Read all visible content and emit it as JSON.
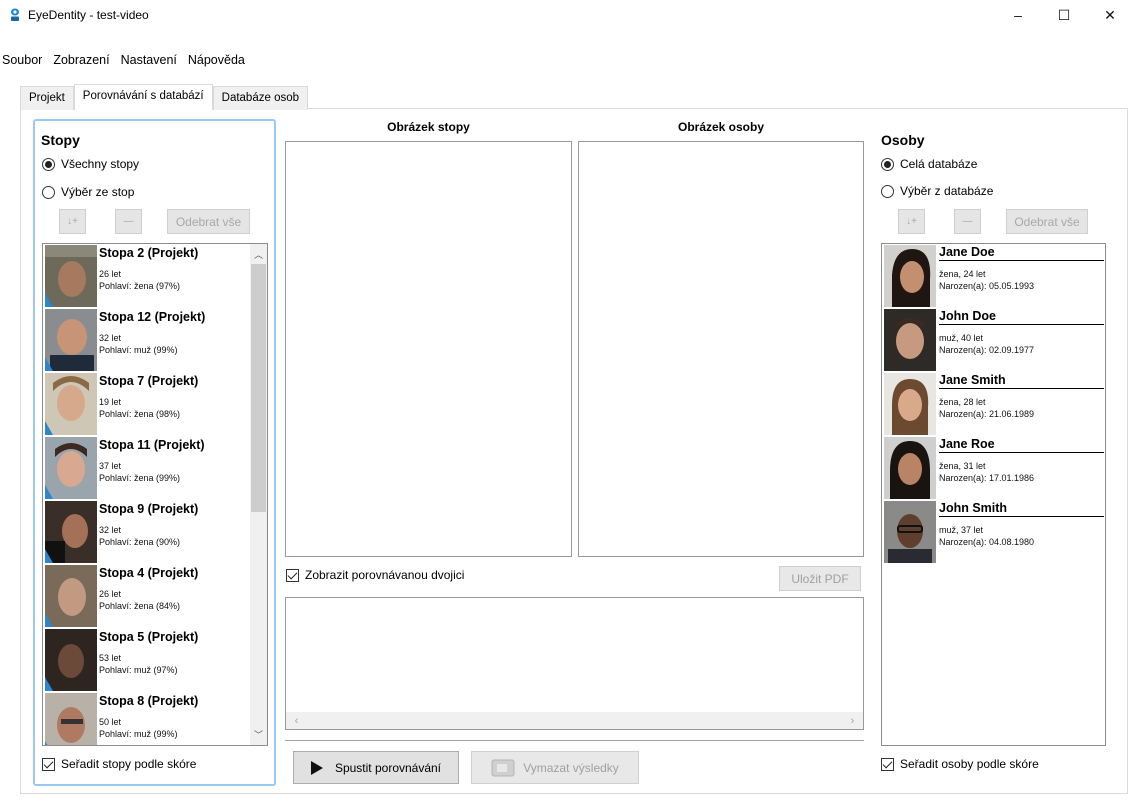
{
  "window": {
    "title": "EyeDentity - test-video",
    "minimize": "–",
    "maximize": "☐",
    "close": "✕"
  },
  "menu": [
    "Soubor",
    "Zobrazení",
    "Nastavení",
    "Nápověda"
  ],
  "tabs": [
    "Projekt",
    "Porovnávání s databází",
    "Databáze osob"
  ],
  "left": {
    "title": "Stopy",
    "radio_all": "Všechny stopy",
    "radio_select": "Výběr ze stop",
    "add_icon": "↓+",
    "remove_icon": "—",
    "remove_all": "Odebrat vše",
    "items": [
      {
        "name": "Stopa 2 (Projekt)",
        "age": "26 let",
        "gender": "Pohlaví: žena (97%)"
      },
      {
        "name": "Stopa 12 (Projekt)",
        "age": "32 let",
        "gender": "Pohlaví: muž (99%)"
      },
      {
        "name": "Stopa 7 (Projekt)",
        "age": "19 let",
        "gender": "Pohlaví: žena (98%)"
      },
      {
        "name": "Stopa 11 (Projekt)",
        "age": "37 let",
        "gender": "Pohlaví: žena (99%)"
      },
      {
        "name": "Stopa 9 (Projekt)",
        "age": "32 let",
        "gender": "Pohlaví: žena (90%)"
      },
      {
        "name": "Stopa 4 (Projekt)",
        "age": "26 let",
        "gender": "Pohlaví: žena (84%)"
      },
      {
        "name": "Stopa 5 (Projekt)",
        "age": "53 let",
        "gender": "Pohlaví: muž (97%)"
      },
      {
        "name": "Stopa 8 (Projekt)",
        "age": "50 let",
        "gender": "Pohlaví: muž (99%)"
      }
    ],
    "sort_label": "Seřadit stopy podle skóre"
  },
  "middle": {
    "track_image_title": "Obrázek stopy",
    "person_image_title": "Obrázek osoby",
    "show_pair_label": "Zobrazit porovnávanou dvojici",
    "save_pdf": "Uložit PDF",
    "run_compare": "Spustit porovnávání",
    "clear_results": "Vymazat výsledky"
  },
  "right": {
    "title": "Osoby",
    "radio_all": "Celá databáze",
    "radio_select": "Výběr z databáze",
    "add_icon": "↓+",
    "remove_icon": "—",
    "remove_all": "Odebrat vše",
    "persons": [
      {
        "name": "Jane Doe",
        "info": "žena, 24 let",
        "born": "Narozen(a): 05.05.1993"
      },
      {
        "name": "John Doe",
        "info": "muž, 40 let",
        "born": "Narozen(a): 02.09.1977"
      },
      {
        "name": "Jane Smith",
        "info": "žena, 28 let",
        "born": "Narozen(a): 21.06.1989"
      },
      {
        "name": "Jane Roe",
        "info": "žena, 31 let",
        "born": "Narozen(a): 17.01.1986"
      },
      {
        "name": "John Smith",
        "info": "muž, 37 let",
        "born": "Narozen(a): 04.08.1980"
      }
    ],
    "sort_label": "Seřadit osoby podle skóre"
  },
  "colors": {
    "focus_border": "#99c9f3",
    "app_icon": "#1e88c8"
  }
}
